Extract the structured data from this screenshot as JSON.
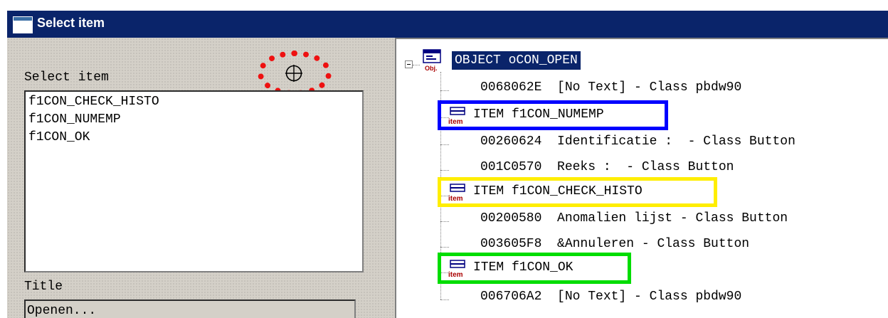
{
  "window": {
    "title": "Select item"
  },
  "left": {
    "select_label": "Select item",
    "items": [
      "f1CON_CHECK_HISTO",
      "f1CON_NUMEMP",
      "f1CON_OK"
    ],
    "title_label": "Title",
    "title_value": "Openen..."
  },
  "tree": {
    "root": "OBJECT oCON_OPEN",
    "rows": [
      "0068062E  [No Text] - Class pbdw90",
      "ITEM f1CON_NUMEMP",
      "00260624  Identificatie :  - Class Button",
      "001C0570  Reeks :  - Class Button",
      "ITEM f1CON_CHECK_HISTO",
      "00200580  Anomalien lijst - Class Button",
      "003605F8  &Annuleren - Class Button",
      "ITEM f1CON_OK",
      "006706A2  [No Text] - Class pbdw90"
    ],
    "obj_icon_label": "Obj.",
    "item_icon_label": "item"
  },
  "colors": {
    "titlebar": "#0a246a",
    "highlight_blue": "#0000ff",
    "highlight_yellow": "#ffee00",
    "highlight_green": "#00dd00",
    "dotted_circle": "#ee1111"
  },
  "icons": [
    "crosshair-icon",
    "object-icon",
    "item-icon",
    "expand-collapse-icon"
  ]
}
